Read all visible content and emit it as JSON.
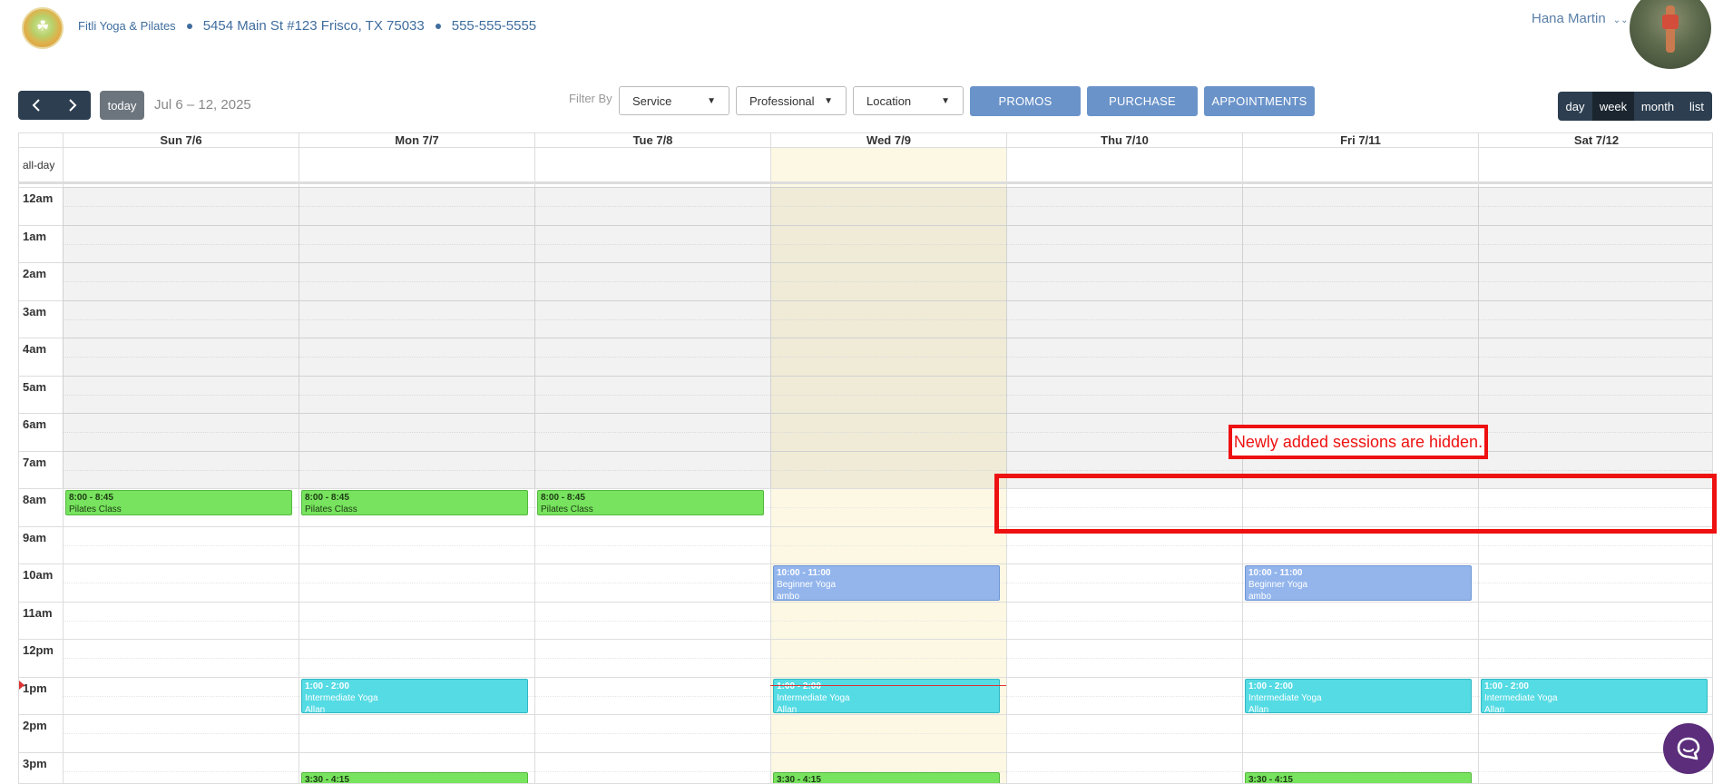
{
  "header": {
    "business_name": "Fitli Yoga & Pilates",
    "address": "5454 Main St #123 Frisco, TX 75033",
    "phone": "555-555-5555",
    "user_name": "Hana Martin"
  },
  "toolbar": {
    "prev_icon": "chevron-left-icon",
    "next_icon": "chevron-right-icon",
    "today_label": "today",
    "date_range": "Jul 6 – 12, 2025",
    "filter_label": "Filter By",
    "service_select": "Service",
    "professional_select": "Professional",
    "location_select": "Location",
    "promos_label": "PROMOS",
    "purchase_label": "PURCHASE",
    "appointments_label": "APPOINTMENTS",
    "views": [
      "day",
      "week",
      "month",
      "list"
    ],
    "active_view": "week"
  },
  "calendar": {
    "allday_label": "all-day",
    "days": [
      "Sun 7/6",
      "Mon 7/7",
      "Tue 7/8",
      "Wed 7/9",
      "Thu 7/10",
      "Fri 7/11",
      "Sat 7/12"
    ],
    "today_index": 3,
    "hours": [
      "12am",
      "1am",
      "2am",
      "3am",
      "4am",
      "5am",
      "6am",
      "7am",
      "8am",
      "9am",
      "10am",
      "11am",
      "12pm",
      "1pm",
      "2pm",
      "3pm"
    ],
    "events": [
      {
        "day": 0,
        "time": "8:00 - 8:45",
        "title": "Pilates Class",
        "color": "green",
        "start": 8,
        "end": 8.75
      },
      {
        "day": 1,
        "time": "8:00 - 8:45",
        "title": "Pilates Class",
        "color": "green",
        "start": 8,
        "end": 8.75
      },
      {
        "day": 2,
        "time": "8:00 - 8:45",
        "title": "Pilates Class",
        "color": "green",
        "start": 8,
        "end": 8.75
      },
      {
        "day": 3,
        "time": "10:00 - 11:00",
        "title": "Beginner Yoga",
        "instructor": "ambo",
        "color": "blue",
        "start": 10,
        "end": 11
      },
      {
        "day": 5,
        "time": "10:00 - 11:00",
        "title": "Beginner Yoga",
        "instructor": "ambo",
        "color": "blue",
        "start": 10,
        "end": 11
      },
      {
        "day": 1,
        "time": "1:00 - 2:00",
        "title": "Intermediate Yoga",
        "instructor": "Allan",
        "color": "cyan",
        "start": 13,
        "end": 14
      },
      {
        "day": 3,
        "time": "1:00 - 2:00",
        "title": "Intermediate Yoga",
        "instructor": "Allan",
        "color": "cyan",
        "start": 13,
        "end": 14
      },
      {
        "day": 5,
        "time": "1:00 - 2:00",
        "title": "Intermediate Yoga",
        "instructor": "Allan",
        "color": "cyan",
        "start": 13,
        "end": 14
      },
      {
        "day": 6,
        "time": "1:00 - 2:00",
        "title": "Intermediate Yoga",
        "instructor": "Allan",
        "color": "cyan",
        "start": 13,
        "end": 14
      },
      {
        "day": 1,
        "time": "3:30 - 4:15",
        "title": "",
        "color": "green",
        "start": 15.5,
        "end": 16.25
      },
      {
        "day": 3,
        "time": "3:30 - 4:15",
        "title": "",
        "color": "green",
        "start": 15.5,
        "end": 16.25
      },
      {
        "day": 5,
        "time": "3:30 - 4:15",
        "title": "",
        "color": "green",
        "start": 15.5,
        "end": 16.25
      }
    ],
    "now_hour": 13.22
  },
  "annotation": {
    "text": "Newly added sessions are hidden."
  },
  "colors": {
    "green": "#77e35e",
    "blue": "#93b5ec",
    "cyan": "#55dbe4",
    "nav": "#2c3e50",
    "action": "#6a93c9",
    "annotation": "#ee1111"
  },
  "chat_icon": "chat-bubble-icon"
}
